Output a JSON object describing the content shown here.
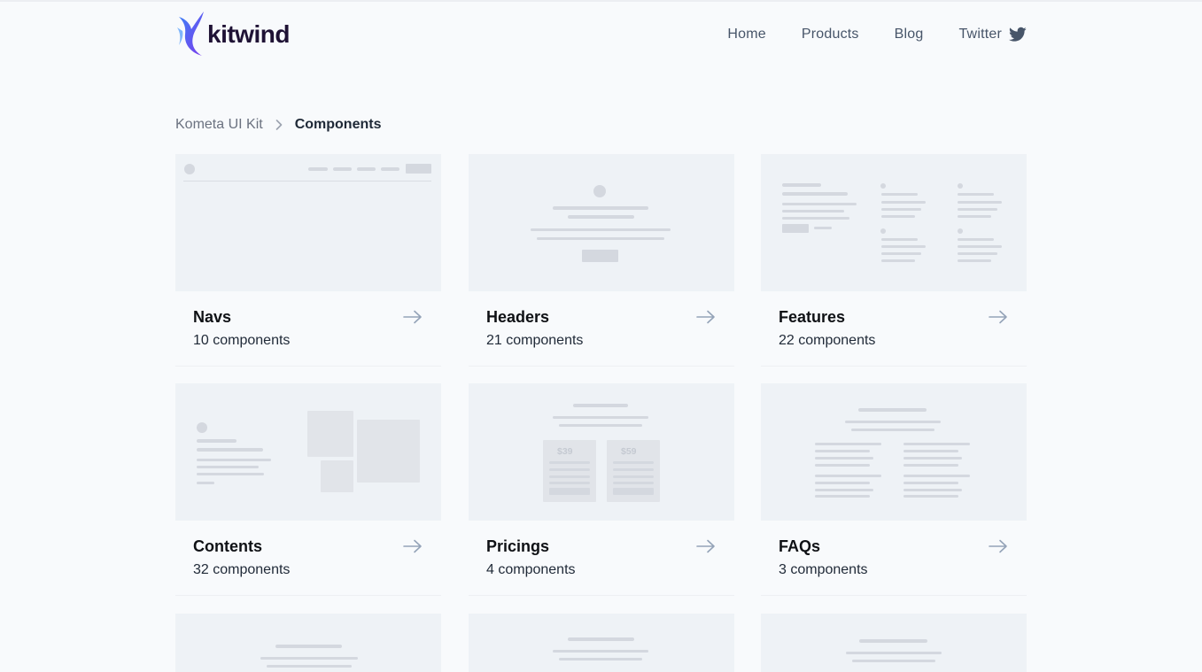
{
  "brand": {
    "name": "kitwind"
  },
  "nav": {
    "items": [
      "Home",
      "Products",
      "Blog"
    ],
    "twitter_label": "Twitter"
  },
  "breadcrumb": {
    "parent": "Kometa UI Kit",
    "current": "Components"
  },
  "thumbnails": {
    "pricing_prices": [
      "$39",
      "$59"
    ]
  },
  "cards": [
    {
      "title": "Navs",
      "count": "10 components"
    },
    {
      "title": "Headers",
      "count": "21 components"
    },
    {
      "title": "Features",
      "count": "22 components"
    },
    {
      "title": "Contents",
      "count": "32 components"
    },
    {
      "title": "Pricings",
      "count": "4 components"
    },
    {
      "title": "FAQs",
      "count": "3 components"
    }
  ],
  "colors": {
    "background": "#f8fafc",
    "thumbnail": "#eef2f6",
    "placeholder": "#d4d8df",
    "logo_gradient": [
      "#7c3aed",
      "#3b82f6"
    ],
    "text_dark": "#0f1115",
    "nav_text": "#475569",
    "arrow": "#94a3b8"
  }
}
